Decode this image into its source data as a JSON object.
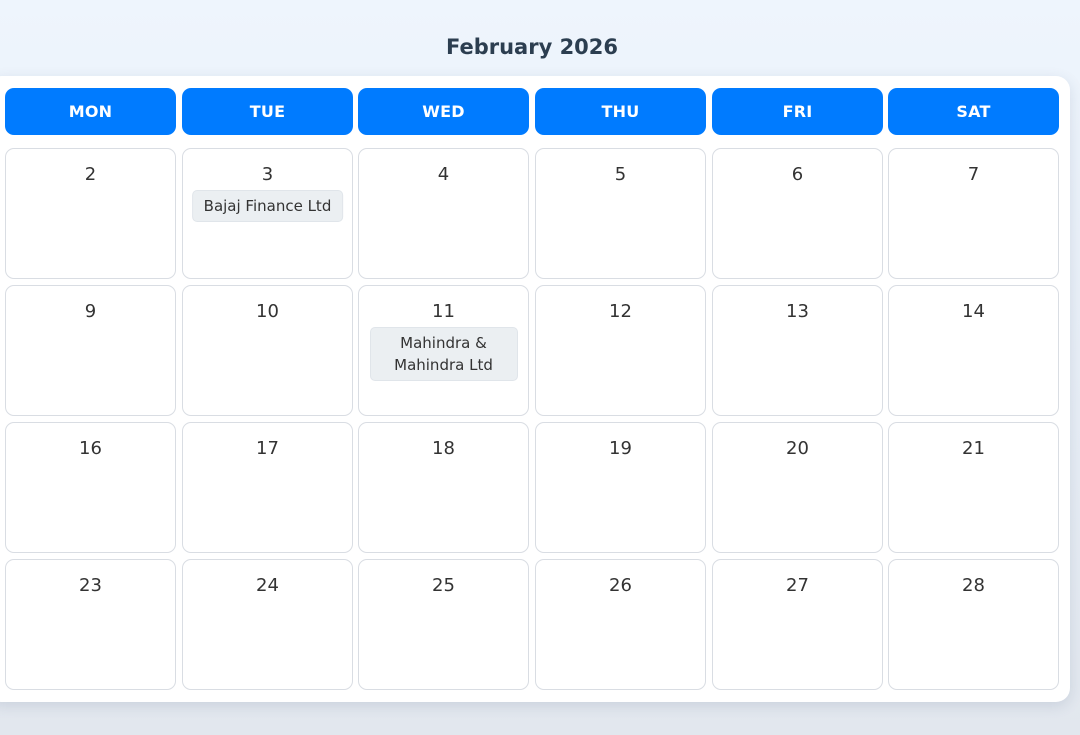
{
  "calendar": {
    "month_title": "February 2026",
    "weekdays": [
      "MON",
      "TUE",
      "WED",
      "THU",
      "FRI",
      "SAT"
    ],
    "weeks": [
      [
        {
          "day": "2",
          "event": ""
        },
        {
          "day": "3",
          "event": "Bajaj Finance Ltd"
        },
        {
          "day": "4",
          "event": ""
        },
        {
          "day": "5",
          "event": ""
        },
        {
          "day": "6",
          "event": ""
        },
        {
          "day": "7",
          "event": ""
        }
      ],
      [
        {
          "day": "9",
          "event": ""
        },
        {
          "day": "10",
          "event": ""
        },
        {
          "day": "11",
          "event": "Mahindra & Mahindra Ltd"
        },
        {
          "day": "12",
          "event": ""
        },
        {
          "day": "13",
          "event": ""
        },
        {
          "day": "14",
          "event": ""
        }
      ],
      [
        {
          "day": "16",
          "event": ""
        },
        {
          "day": "17",
          "event": ""
        },
        {
          "day": "18",
          "event": ""
        },
        {
          "day": "19",
          "event": ""
        },
        {
          "day": "20",
          "event": ""
        },
        {
          "day": "21",
          "event": ""
        }
      ],
      [
        {
          "day": "23",
          "event": ""
        },
        {
          "day": "24",
          "event": ""
        },
        {
          "day": "25",
          "event": ""
        },
        {
          "day": "26",
          "event": ""
        },
        {
          "day": "27",
          "event": ""
        },
        {
          "day": "28",
          "event": ""
        }
      ]
    ]
  },
  "colors": {
    "header_bg": "#007bff",
    "header_text": "#ffffff",
    "title_text": "#2c3e50",
    "event_bg": "#ebeff2",
    "cell_border": "#d9dde3"
  }
}
